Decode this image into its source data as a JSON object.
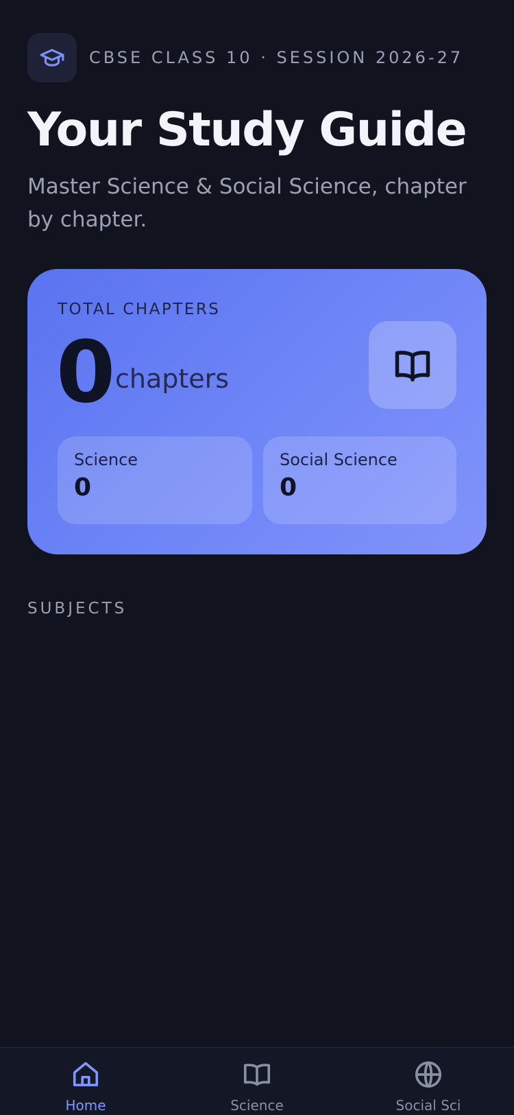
{
  "header": {
    "session_label": "CBSE CLASS 10 · SESSION 2026-27",
    "title": "Your Study Guide",
    "subtitle": "Master Science & Social Science, chapter by chapter."
  },
  "summary_card": {
    "label": "TOTAL CHAPTERS",
    "total": "0",
    "unit": "chapters",
    "breakdown": [
      {
        "label": "Science",
        "value": "0"
      },
      {
        "label": "Social Science",
        "value": "0"
      }
    ]
  },
  "subjects_section": {
    "heading": "SUBJECTS",
    "items": []
  },
  "bottom_nav": {
    "items": [
      {
        "label": "Home",
        "icon": "home-icon",
        "active": true
      },
      {
        "label": "Science",
        "icon": "book-icon",
        "active": false
      },
      {
        "label": "Social Sci",
        "icon": "globe-icon",
        "active": false
      }
    ]
  },
  "colors": {
    "background": "#11141f",
    "accent": "#8196ff",
    "card_gradient_start": "#5a74f0",
    "card_gradient_end": "#8193fa"
  }
}
